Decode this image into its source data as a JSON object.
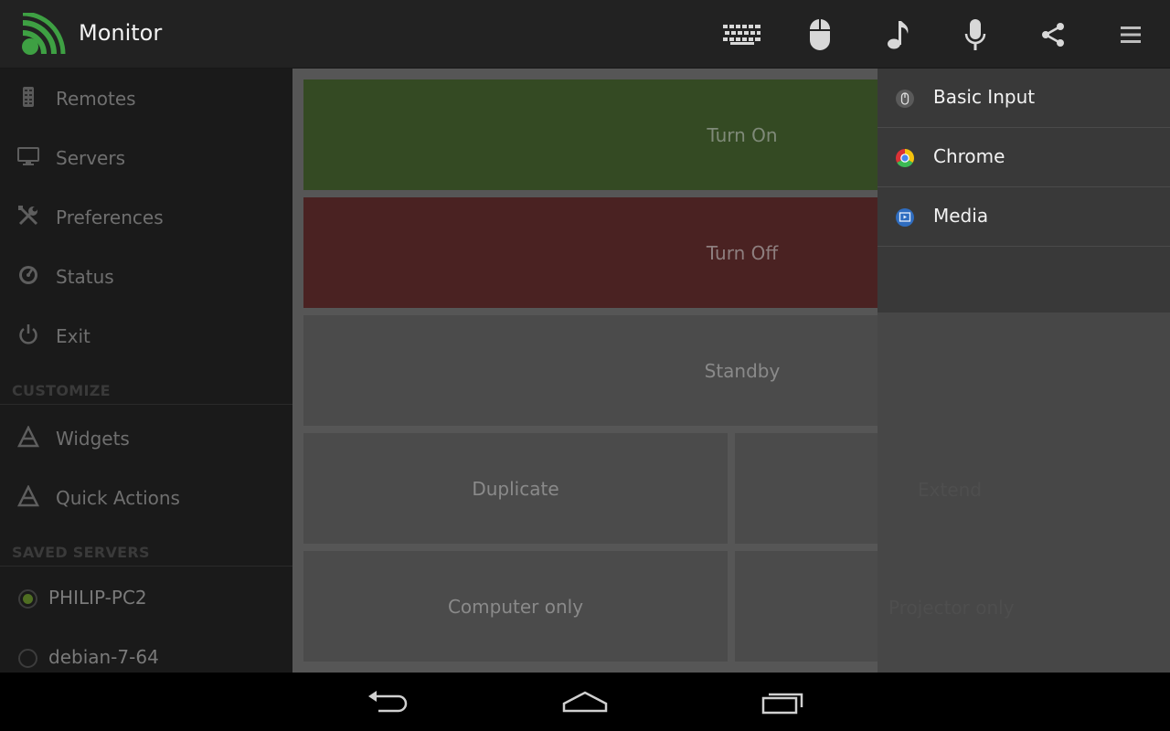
{
  "app": {
    "title": "Monitor",
    "logo_icon": "wifi-cast-icon",
    "accent_color": "#4caf50"
  },
  "actionbar": {
    "buttons": [
      {
        "name": "keyboard",
        "icon": "keyboard-icon"
      },
      {
        "name": "mouse",
        "icon": "mouse-icon"
      },
      {
        "name": "music",
        "icon": "music-note-icon"
      },
      {
        "name": "microphone",
        "icon": "microphone-icon"
      },
      {
        "name": "share",
        "icon": "share-icon"
      },
      {
        "name": "overflow-menu",
        "icon": "menu-icon"
      }
    ]
  },
  "drawer": {
    "nav": [
      {
        "label": "Remotes",
        "icon": "remote-control-icon"
      },
      {
        "label": "Servers",
        "icon": "monitor-icon"
      },
      {
        "label": "Preferences",
        "icon": "tools-icon"
      },
      {
        "label": "Status",
        "icon": "gauge-icon"
      },
      {
        "label": "Exit",
        "icon": "power-icon"
      }
    ],
    "customize_header": "CUSTOMIZE",
    "customize": [
      {
        "label": "Widgets",
        "icon": "widgets-icon"
      },
      {
        "label": "Quick Actions",
        "icon": "quick-actions-icon"
      }
    ],
    "saved_servers_header": "SAVED SERVERS",
    "servers": [
      {
        "label": "PHILIP-PC2",
        "selected": true
      },
      {
        "label": "debian-7-64",
        "selected": false
      }
    ]
  },
  "main": {
    "tiles": {
      "turn_on": "Turn On",
      "turn_off": "Turn Off",
      "standby": "Standby",
      "duplicate": "Duplicate",
      "extend": "Extend",
      "computer_only": "Computer only",
      "projector_only": "Projector only"
    },
    "colors": {
      "on": "#344a23",
      "off": "#4a2222",
      "neutral": "#4b4b4b"
    }
  },
  "dropdown": {
    "items": [
      {
        "label": "Basic Input",
        "icon": "mouse-icon"
      },
      {
        "label": "Chrome",
        "icon": "chrome-icon"
      },
      {
        "label": "Media",
        "icon": "media-icon"
      }
    ]
  },
  "system_nav": {
    "buttons": [
      {
        "name": "back",
        "icon": "back-icon"
      },
      {
        "name": "home",
        "icon": "home-icon"
      },
      {
        "name": "recents",
        "icon": "recents-icon"
      }
    ]
  }
}
